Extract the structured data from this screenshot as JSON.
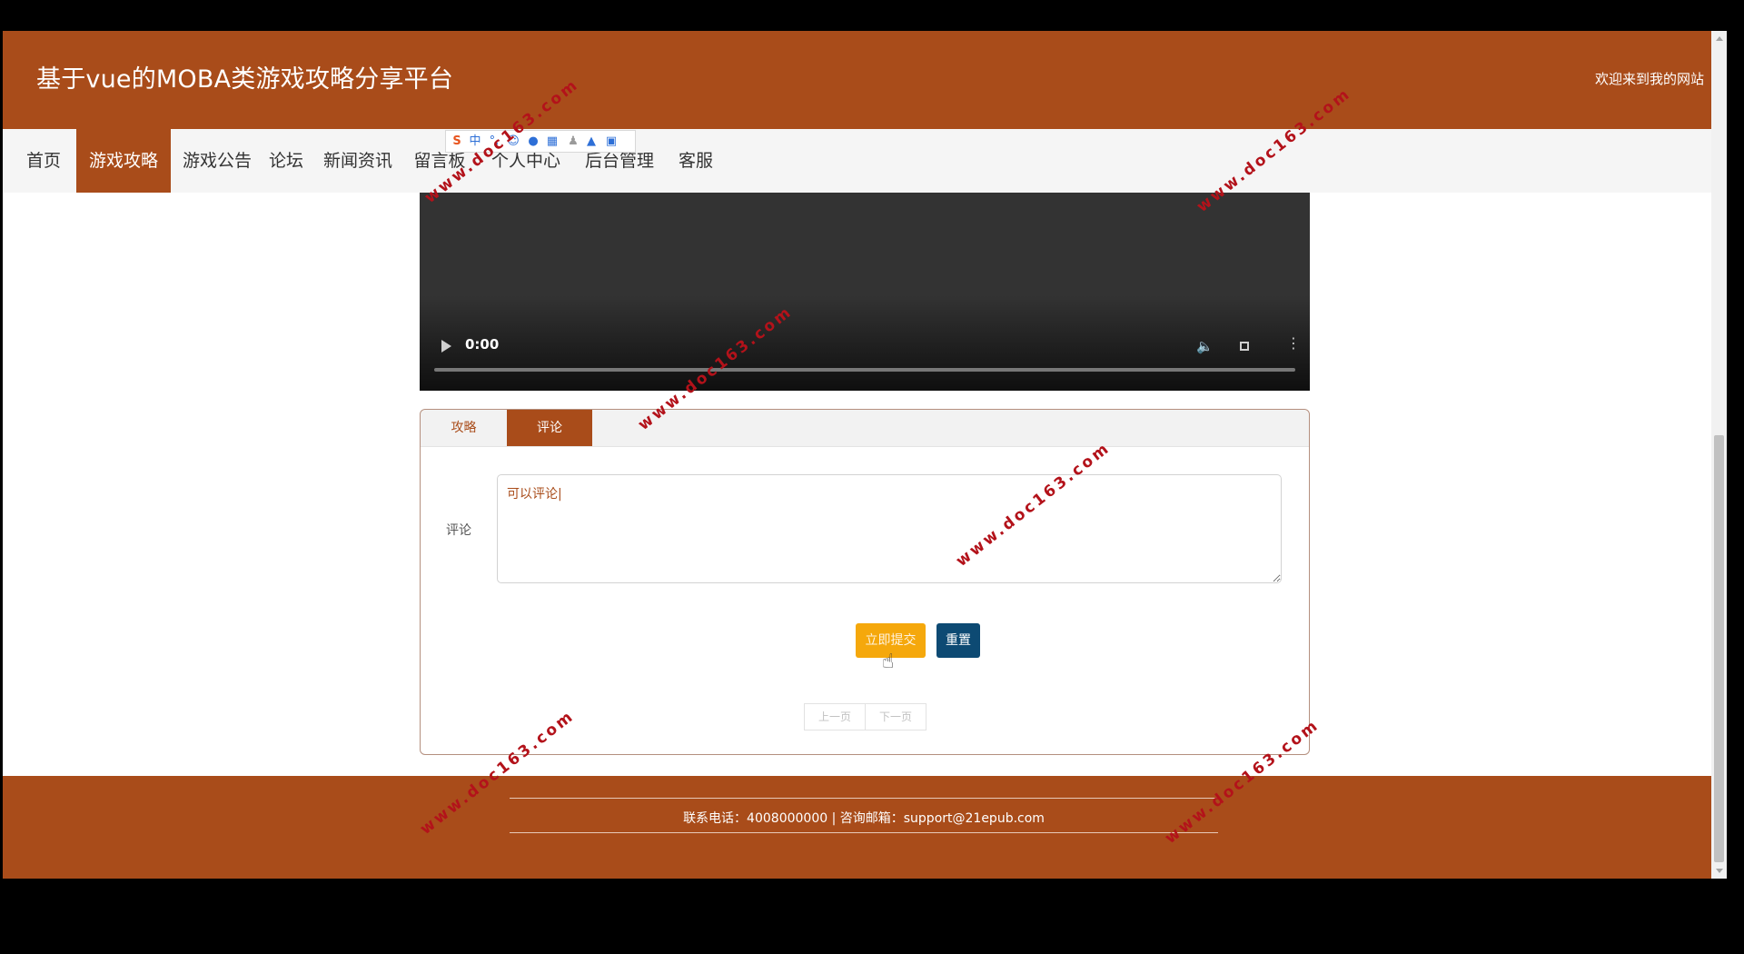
{
  "header": {
    "site_title": "基于vue的MOBA类游戏攻略分享平台",
    "welcome": "欢迎来到我的网站"
  },
  "nav": {
    "items": [
      {
        "label": "首页"
      },
      {
        "label": "游戏攻略",
        "active": true
      },
      {
        "label": "游戏公告"
      },
      {
        "label": "论坛"
      },
      {
        "label": "新闻资讯"
      },
      {
        "label": "留言板"
      },
      {
        "label": "个人中心"
      },
      {
        "label": "后台管理"
      },
      {
        "label": "客服"
      }
    ]
  },
  "ime_toolbar": {
    "mode": "中",
    "punct": "°,",
    "icons": [
      "sogou-logo-icon",
      "emoji-icon",
      "microphone-icon",
      "keyboard-icon",
      "user-icon",
      "skin-shirt-icon",
      "grid-toolbox-icon"
    ]
  },
  "video": {
    "time": "0:00"
  },
  "tabs": [
    {
      "label": "攻略"
    },
    {
      "label": "评论",
      "active": true
    }
  ],
  "comment_form": {
    "label": "评论",
    "value": "可以评论|",
    "submit_label": "立即提交",
    "reset_label": "重置"
  },
  "pager": {
    "prev": "上一页",
    "next": "下一页"
  },
  "footer": {
    "contact": "联系电话：4008000000 | 咨询邮箱：support@21epub.com"
  },
  "watermark": {
    "text": "www.doc163.com"
  },
  "colors": {
    "brand": "#a94c1a",
    "submit": "#f5a80c",
    "reset": "#0d4a73",
    "watermark": "#b3121a"
  }
}
